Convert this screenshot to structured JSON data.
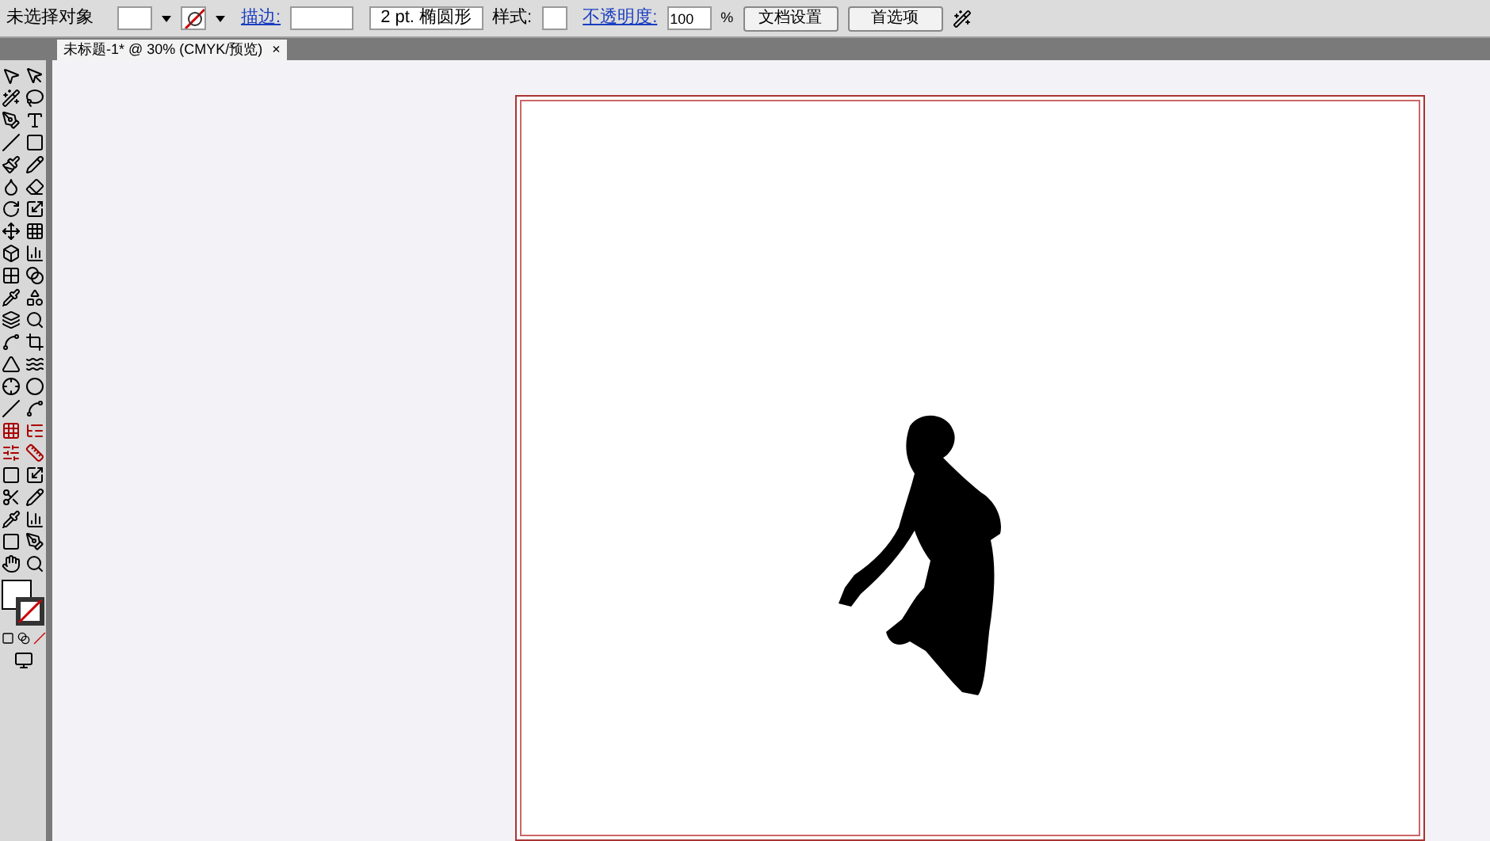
{
  "control_bar": {
    "selection_label": "未选择对象",
    "stroke_label": "描边:",
    "brush_value": "2 pt. 椭圆形",
    "style_label": "样式:",
    "opacity_label": "不透明度:",
    "opacity_value": "100",
    "opacity_unit": "%",
    "buttons": [
      "文档设置",
      "首选项"
    ]
  },
  "tabs": [
    {
      "label": "未标题-1* @ 30% (CMYK/预览)",
      "close": "×",
      "selected": true
    }
  ]
}
